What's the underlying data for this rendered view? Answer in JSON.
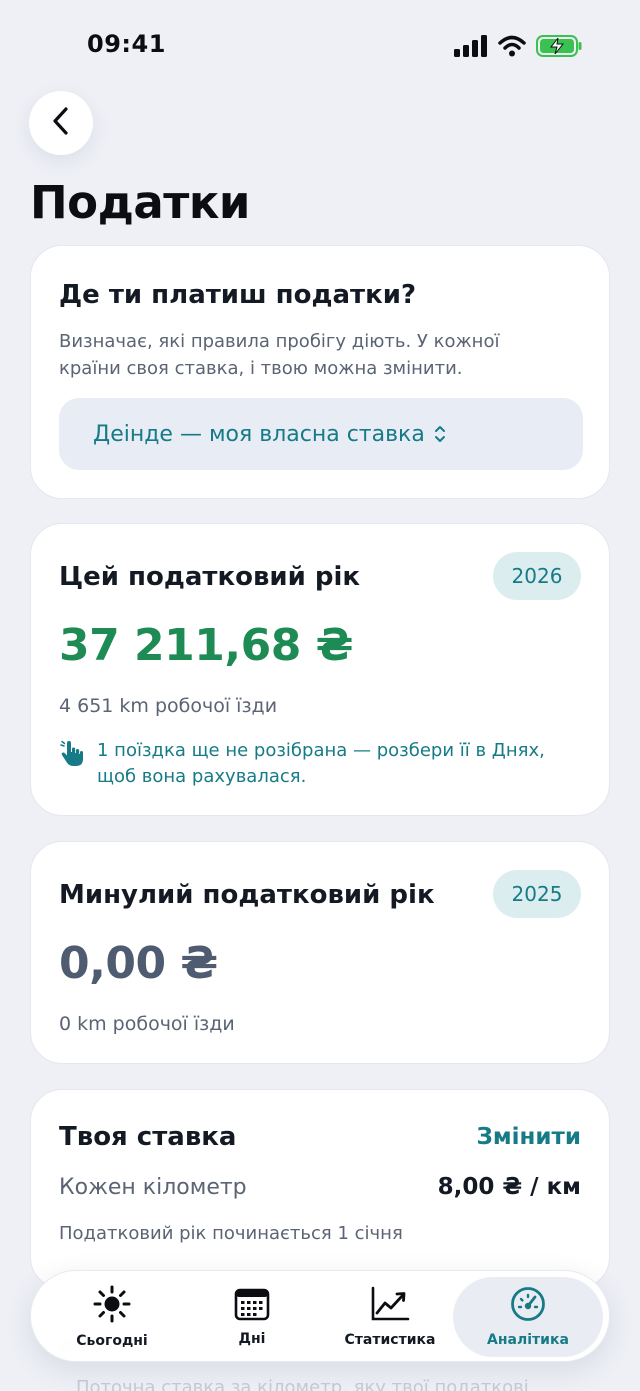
{
  "status": {
    "time": "09:41"
  },
  "page": {
    "title": "Податки"
  },
  "country_card": {
    "title": "Де ти платиш податки?",
    "description": "Визначає, які правила пробігу діють. У кожної країни своя ставка, і твою можна змінити.",
    "selected_option": "Деінде — моя власна ставка"
  },
  "current_year_card": {
    "title": "Цей податковий рік",
    "year": "2026",
    "amount": "37 211,68 ₴",
    "distance": "4 651 km робочої їзди",
    "hint": "1 поїздка ще не розібрана — розбери її в Днях, щоб вона рахувалася."
  },
  "previous_year_card": {
    "title": "Минулий податковий рік",
    "year": "2025",
    "amount": "0,00 ₴",
    "distance": "0 km робочої їзди"
  },
  "rate_card": {
    "title": "Твоя ставка",
    "change_label": "Змінити",
    "row_label": "Кожен кілометр",
    "row_value": "8,00 ₴ / км",
    "note": "Податковий рік починається 1 січня"
  },
  "behind_text": "Поточна ставка за кілометр, яку твої податкові",
  "tabs": [
    {
      "label": "Сьогодні",
      "icon": "sun-icon",
      "active": false
    },
    {
      "label": "Дні",
      "icon": "calendar-icon",
      "active": false
    },
    {
      "label": "Статистика",
      "icon": "chart-icon",
      "active": false
    },
    {
      "label": "Аналітика",
      "icon": "gauge-icon",
      "active": true
    }
  ],
  "colors": {
    "accent": "#167b86",
    "positive": "#1e8a54",
    "neutral_amount": "#4f5b70",
    "background": "#eef0f6"
  }
}
